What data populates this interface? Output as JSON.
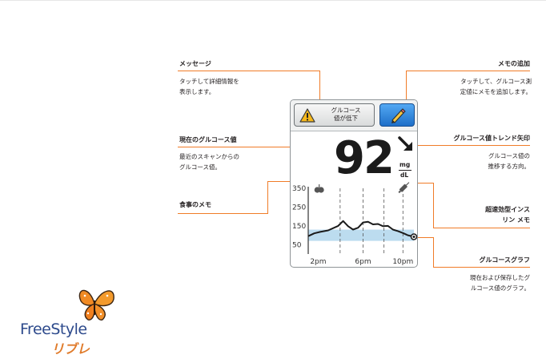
{
  "callouts": {
    "message": {
      "title": "メッセージ",
      "desc": "タッチして詳細情報を\n表示します。"
    },
    "note_add": {
      "title": "メモの追加",
      "desc": "タッチして、グルコース測\n定値にメモを追加します。"
    },
    "current": {
      "title": "現在のグルコース値",
      "desc": "最近のスキャンからの\nグルコース値。"
    },
    "trend": {
      "title": "グルコース値トレンド矢印",
      "desc": "グルコース値の\n推移する方向。"
    },
    "food": {
      "title": "食事のメモ"
    },
    "insulin": {
      "title": "超速効型インス\nリン メモ"
    },
    "graph": {
      "title": "グルコースグラフ",
      "desc": "現在および保存したグ\nルコース値のグラフ。"
    }
  },
  "device": {
    "message_button": "グルコース\n値が低下",
    "glucose_value": "92",
    "unit_top": "mg",
    "unit_bottom": "dL"
  },
  "brand": {
    "name": "FreeStyle",
    "sub": "リブレ"
  },
  "icons": [
    "warning-icon",
    "pencil-icon",
    "trend-arrow-icon",
    "apple-icon",
    "syringe-icon",
    "butterfly-logo"
  ],
  "colors": {
    "callout": "#f07c28",
    "brand_blue": "#2d4a8c",
    "brand_orange": "#e07b2b",
    "target_band": "#bcdcef"
  },
  "chart_data": {
    "type": "line",
    "y_ticks": [
      350,
      250,
      150,
      50
    ],
    "x_ticks": [
      "2pm",
      "6pm",
      "10pm"
    ],
    "ylim": [
      0,
      350
    ],
    "target_range": [
      70,
      130
    ],
    "series": [
      {
        "x": [
          0,
          0.6,
          1.2,
          2,
          3,
          3.5,
          4,
          4.5,
          5,
          5.5,
          6,
          6.5,
          7,
          7.5,
          8,
          8.5,
          9,
          9.5,
          10,
          10.6
        ],
        "values": [
          95,
          110,
          118,
          126,
          150,
          176,
          148,
          130,
          140,
          168,
          172,
          158,
          160,
          148,
          150,
          130,
          122,
          112,
          100,
          92
        ]
      }
    ]
  }
}
